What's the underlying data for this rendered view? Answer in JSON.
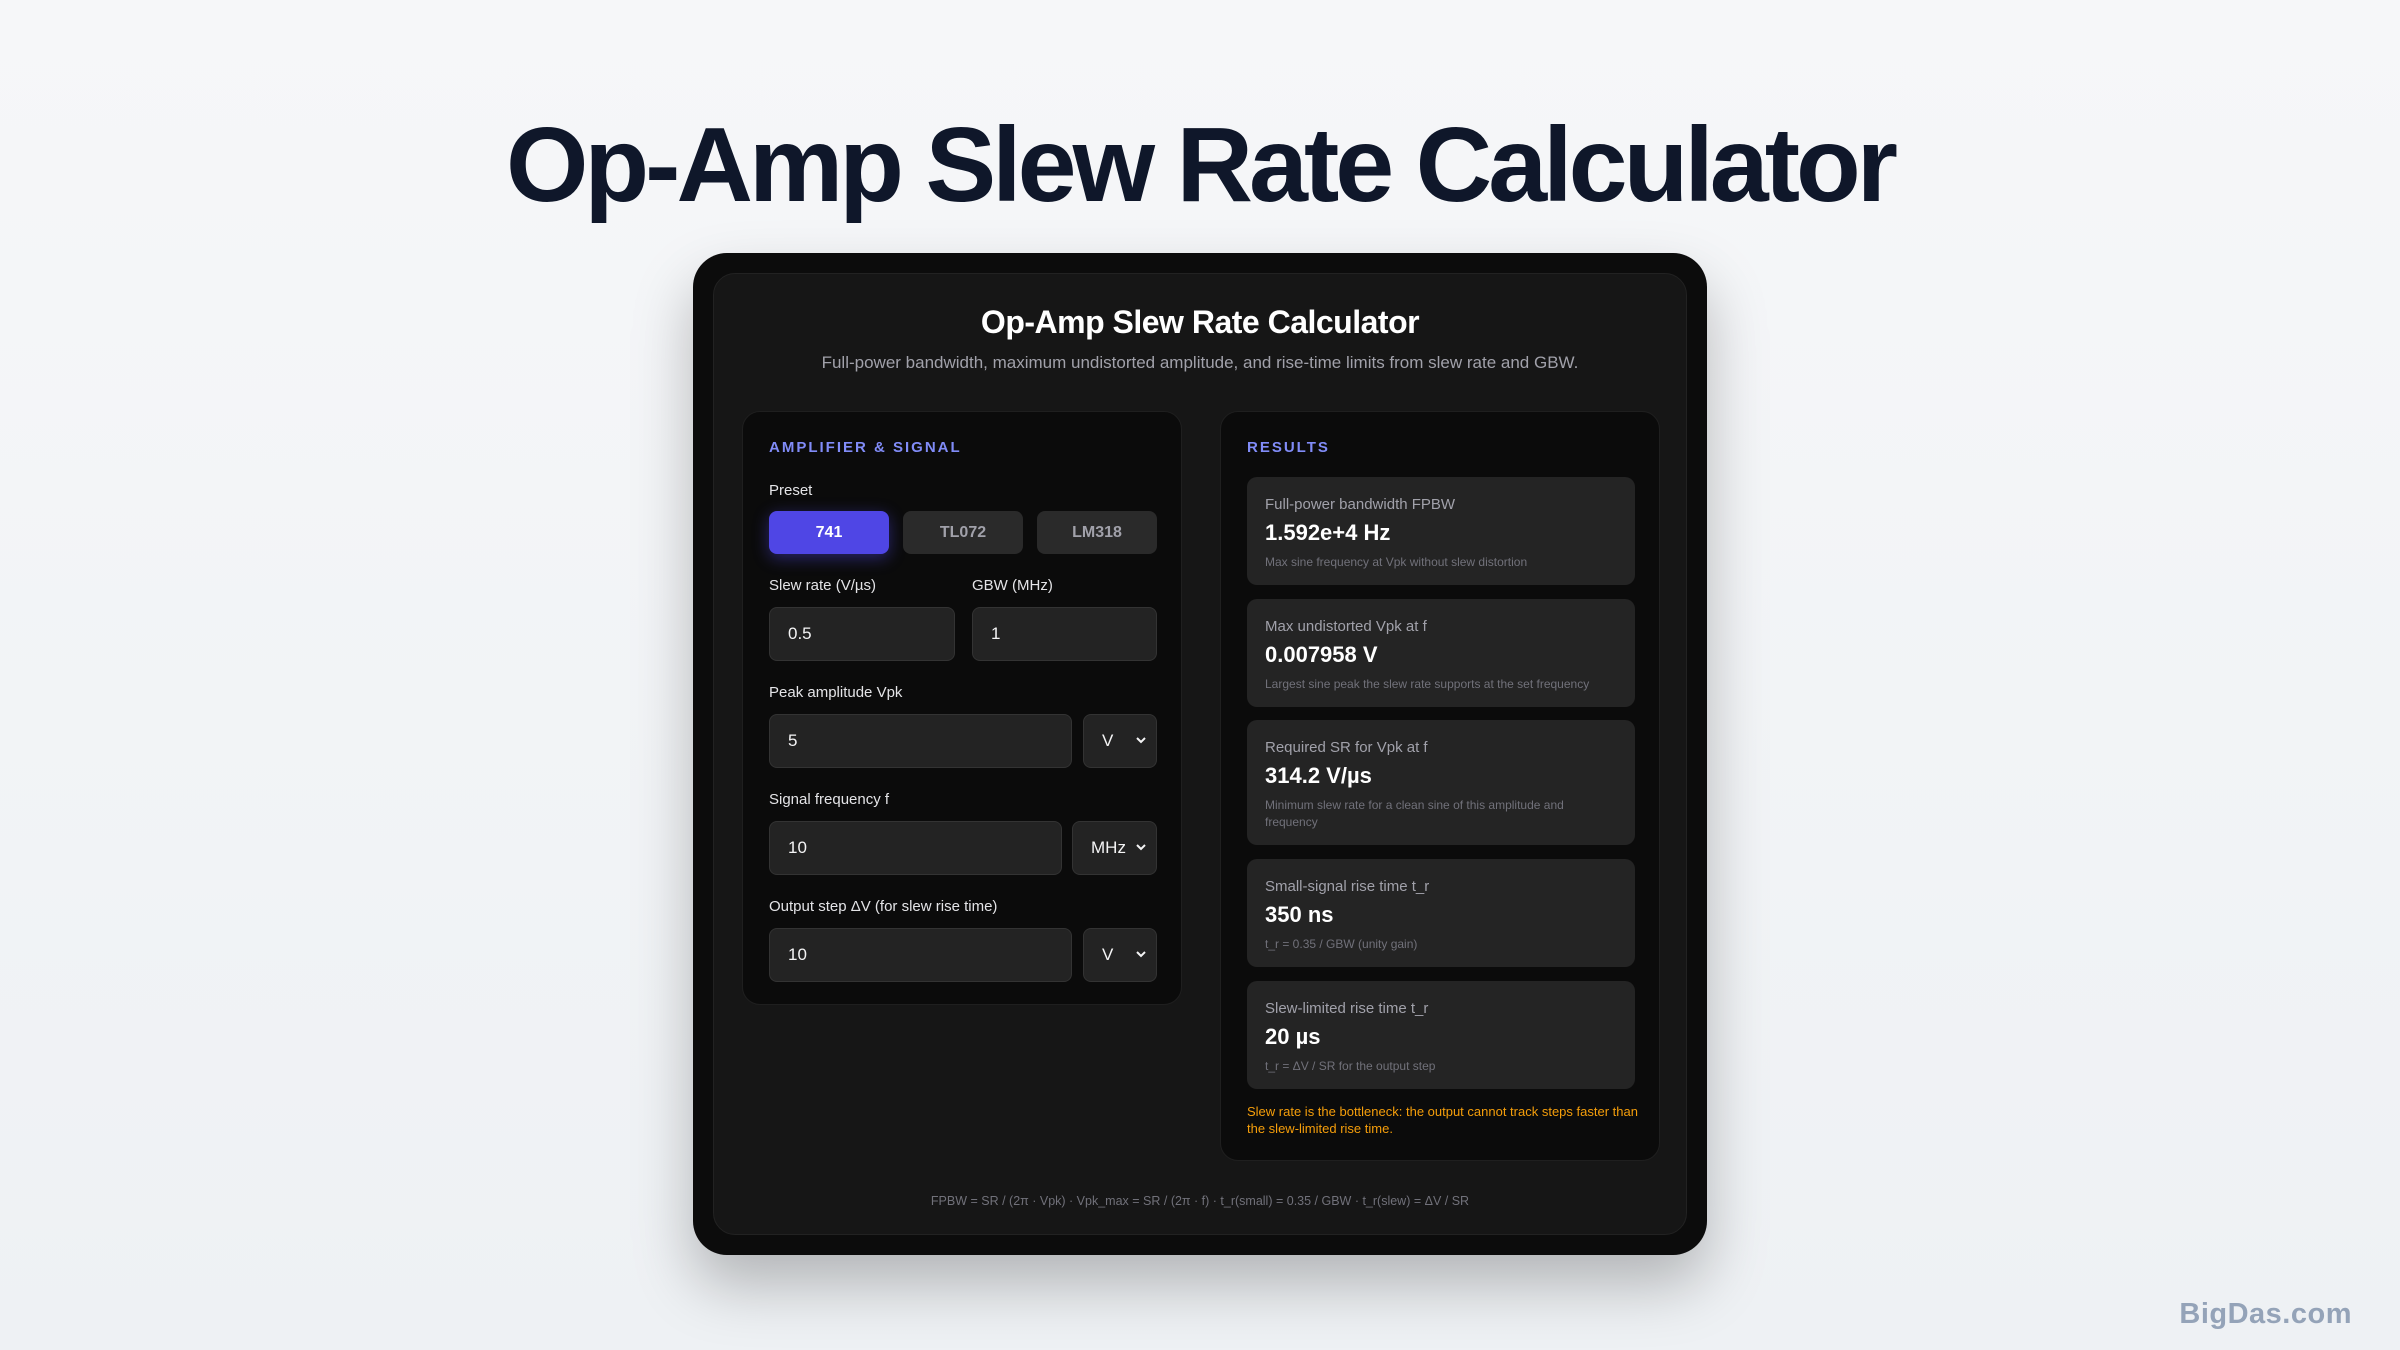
{
  "page_title": "Op-Amp Slew Rate Calculator",
  "app": {
    "title": "Op-Amp Slew Rate Calculator",
    "subtitle": "Full-power bandwidth, maximum undistorted amplitude, and rise-time limits from slew rate and GBW."
  },
  "inputs": {
    "header": "AMPLIFIER & SIGNAL",
    "preset_label": "Preset",
    "presets": [
      "741",
      "TL072",
      "LM318"
    ],
    "active_preset": "741",
    "slew_rate_label": "Slew rate (V/µs)",
    "slew_rate_value": "0.5",
    "gbw_label": "GBW (MHz)",
    "gbw_value": "1",
    "peak_label": "Peak amplitude Vpk",
    "peak_value": "5",
    "peak_unit": "V",
    "freq_label": "Signal frequency f",
    "freq_value": "10",
    "freq_unit": "MHz",
    "step_label": "Output step ΔV (for slew rise time)",
    "step_value": "10",
    "step_unit": "V"
  },
  "results": {
    "header": "RESULTS",
    "cards": [
      {
        "label": "Full-power bandwidth FPBW",
        "value": "1.592e+4 Hz",
        "note": "Max sine frequency at Vpk without slew distortion"
      },
      {
        "label": "Max undistorted Vpk at f",
        "value": "0.007958 V",
        "note": "Largest sine peak the slew rate supports at the set frequency"
      },
      {
        "label": "Required SR for Vpk at f",
        "value": "314.2 V/µs",
        "note": "Minimum slew rate for a clean sine of this amplitude and frequency"
      },
      {
        "label": "Small-signal rise time t_r",
        "value": "350 ns",
        "note": "t_r = 0.35 / GBW (unity gain)"
      },
      {
        "label": "Slew-limited rise time t_r",
        "value": "20 µs",
        "note": "t_r = ΔV / SR for the output step"
      }
    ],
    "warning": "Slew rate is the bottleneck: the output cannot track steps faster than the slew-limited rise time."
  },
  "formula": "FPBW = SR / (2π · Vpk) · Vpk_max = SR / (2π · f) · t_r(small) = 0.35 / GBW · t_r(slew) = ΔV / SR",
  "watermark": "BigDas.com",
  "colors": {
    "accent": "#4f46e5",
    "header_accent": "#818cf8",
    "warning": "#f59e0b"
  }
}
